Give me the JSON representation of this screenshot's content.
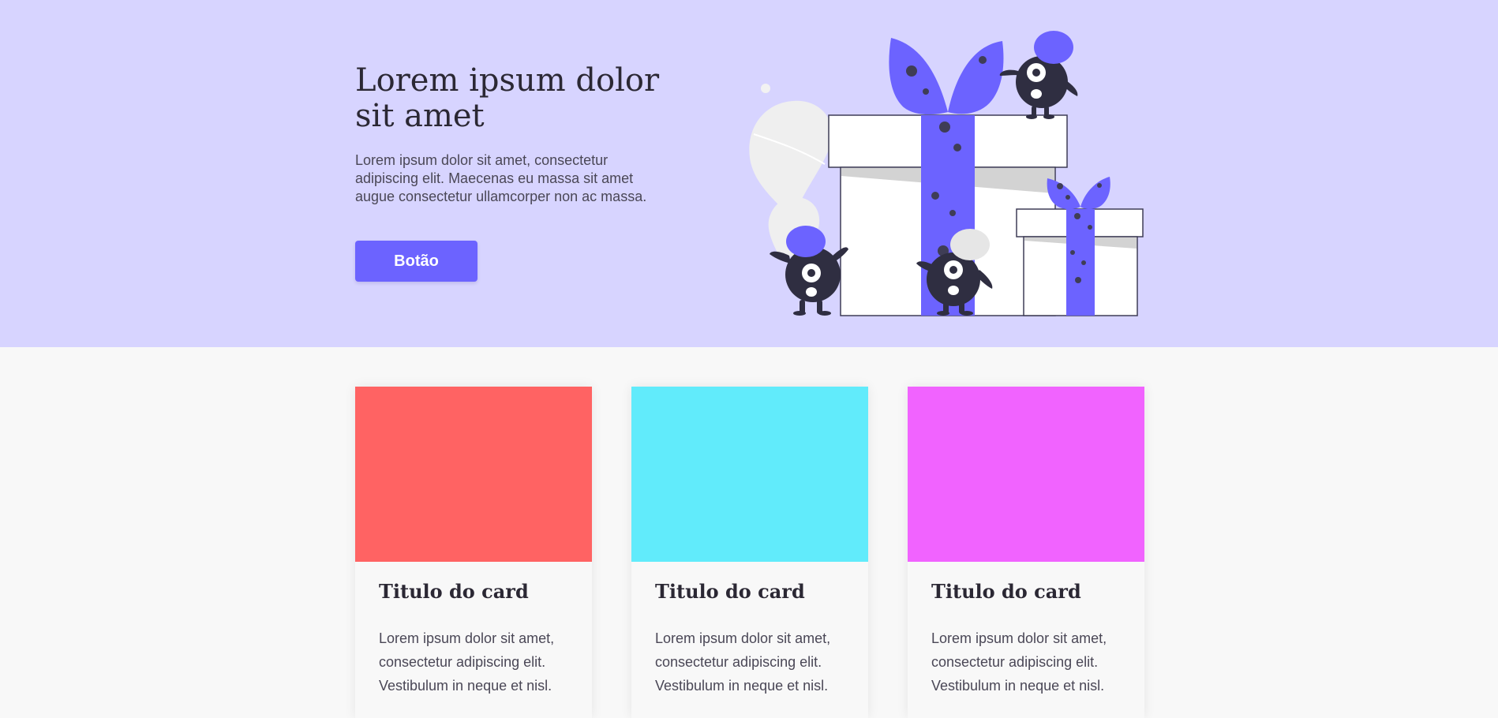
{
  "hero": {
    "title": "Lorem ipsum dolor sit amet",
    "text": "Lorem ipsum dolor sit amet, consectetur adipiscing elit. Maecenas eu massa sit amet augue consectetur ullamcorper non ac massa.",
    "button_label": "Botão",
    "background_color": "#d7d4ff",
    "accent_color": "#6c63ff",
    "illustration": "gift-boxes-monsters-illustration"
  },
  "cards": [
    {
      "title": "Titulo do card",
      "text": "Lorem ipsum dolor sit amet, consectetur adipiscing elit. Vestibulum in neque et nisl.",
      "image_color": "#ff6363"
    },
    {
      "title": "Titulo do card",
      "text": "Lorem ipsum dolor sit amet, consectetur adipiscing elit. Vestibulum in neque et nisl.",
      "image_color": "#61ebfb"
    },
    {
      "title": "Titulo do card",
      "text": "Lorem ipsum dolor sit amet, consectetur adipiscing elit. Vestibulum in neque et nisl.",
      "image_color": "#f163ff"
    }
  ]
}
